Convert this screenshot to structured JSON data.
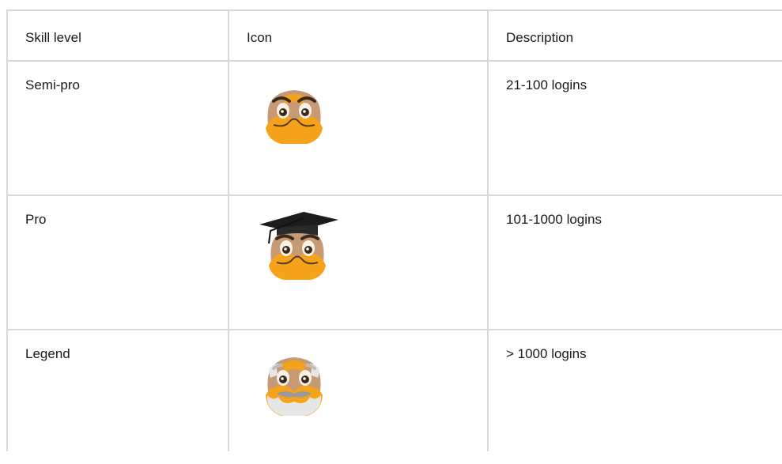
{
  "table": {
    "headers": [
      "Skill level",
      "Icon",
      "Description"
    ],
    "rows": [
      {
        "level": "Semi-pro",
        "icon": "semi-pro-mascot-icon",
        "description": "21-100 logins"
      },
      {
        "level": "Pro",
        "icon": "pro-mascot-graduation-cap-icon",
        "description": "101-1000 logins"
      },
      {
        "level": "Legend",
        "icon": "legend-mascot-beard-icon",
        "description": "> 1000 logins"
      }
    ]
  },
  "colors": {
    "border": "#d8d8d8",
    "mascot_orange": "#f7a21b",
    "mascot_tan": "#c79a76",
    "cap_black": "#1c1c1c",
    "beard_grey": "#e6e6e6"
  }
}
